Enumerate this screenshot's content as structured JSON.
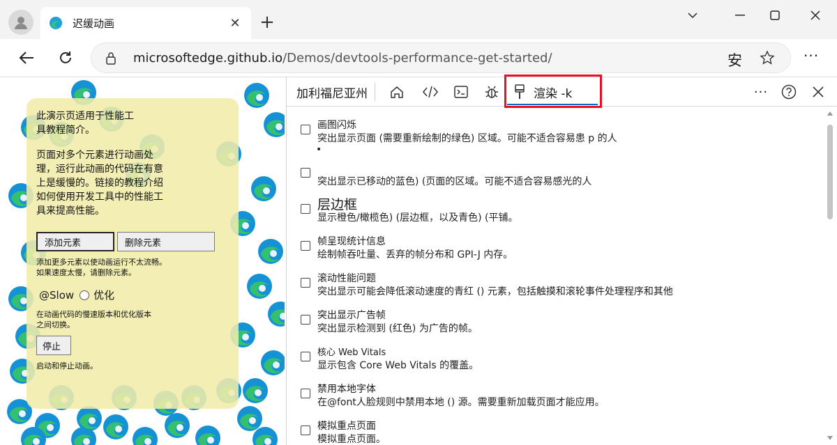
{
  "browser": {
    "tab_title": "迟缓动画",
    "url_domain": "microsoftedge.github.io",
    "url_path": "/Demos/devtools-performance-get-started/",
    "safe_label": "安"
  },
  "demo": {
    "intro": "此演示页适用于性能工具教程简介。",
    "description": "页面对多个元素进行动画处理，运行此动画的代码在有意上是缓慢的。链接的教程介绍如何使用开发工具中的性能工具来提高性能。",
    "add_button": "添加元素",
    "remove_button": "删除元素",
    "add_hint": "添加更多元素以使动画运行不太流畅。如果速度太慢，请删除元素。",
    "slow_label": "@Slow",
    "optimize_label": "优化",
    "mode_hint": "在动画代码的慢速版本和优化版本之间切换。",
    "stop_button": "停止",
    "stop_hint": "启动和停止动画。"
  },
  "devtools": {
    "first_tab": "加利福尼亚州",
    "active_tab": "渲染 -k",
    "options": [
      {
        "title": "画图闪烁",
        "desc": "突出显示页面 (需要重新绘制的绿色) 区域。可能不适合容易患 p 的人",
        "extra": "•"
      },
      {
        "title": "",
        "desc": "突出显示已移动的蓝色) (页面的区域。可能不适合容易感光的人"
      },
      {
        "title": "层边框",
        "desc": "显示橙色/橄榄色) (层边框，以及青色) (平铺。"
      },
      {
        "title": "帧呈现统计信息",
        "desc": "绘制帧吞吐量、丢弃的帧分布和 GPI-J 内存。"
      },
      {
        "title": "滚动性能问题",
        "desc": "突出显示可能会降低滚动速度的青红 () 元素，包括触摸和滚轮事件处理程序和其他"
      },
      {
        "title": "突出显示广告帧",
        "desc": "突出显示检测到 (红色) 为广告的帧。"
      },
      {
        "title": "核心 Web Vitals",
        "desc": "显示包含 Core Web Vitals 的覆盖。"
      },
      {
        "title": "禁用本地字体",
        "desc": "在@font人脸规则中禁用本地 () 源。需要重新加载页面才能应用。"
      },
      {
        "title": "模拟重点页面",
        "desc": "模拟重点页面。"
      }
    ]
  },
  "colors": {
    "accent": "#0f6cbd",
    "highlight": "#e81123",
    "panel": "#f0ecaa"
  }
}
